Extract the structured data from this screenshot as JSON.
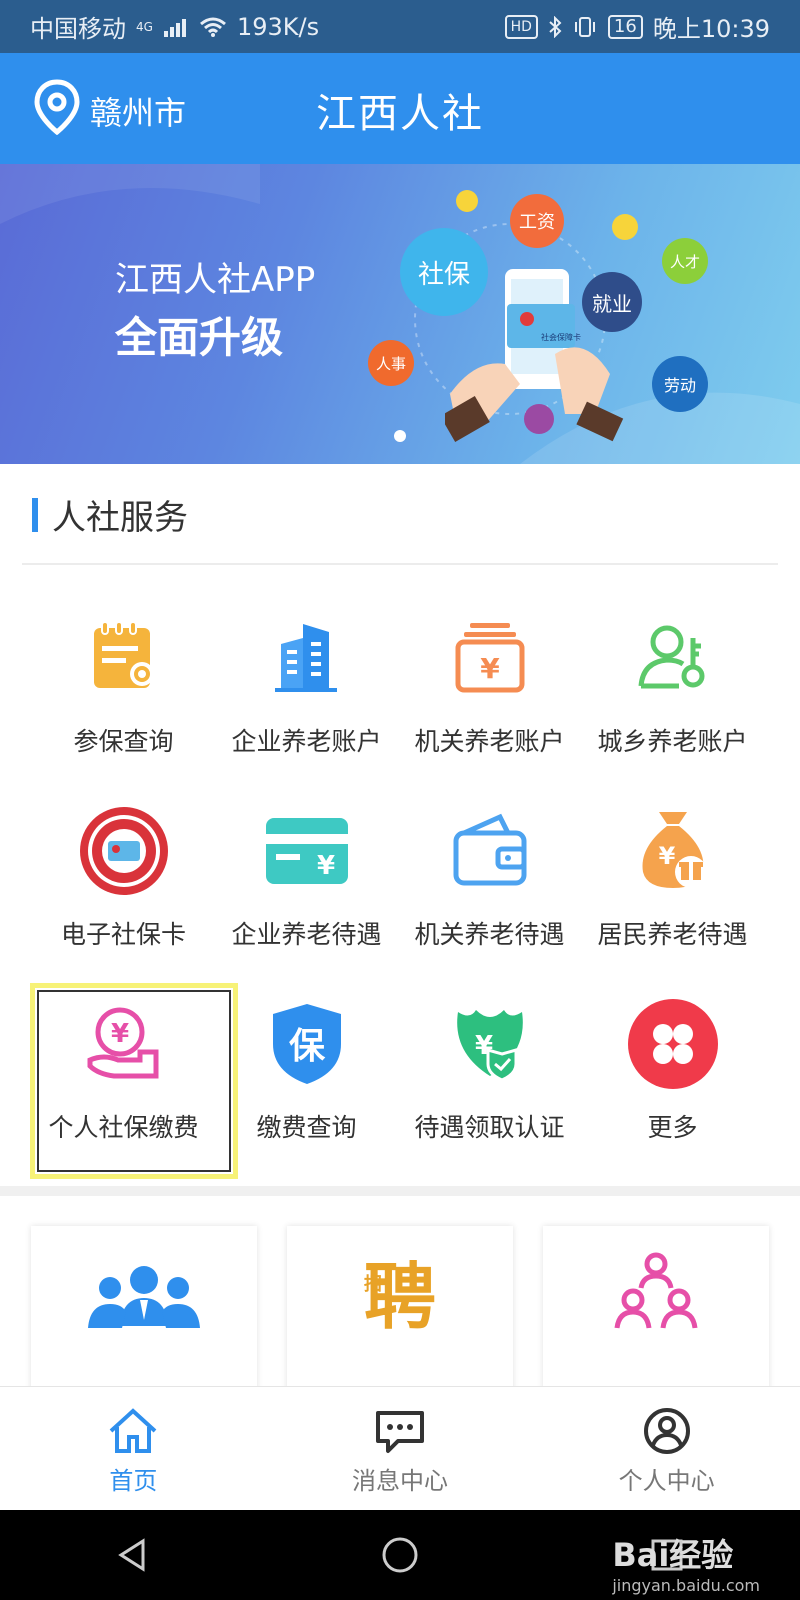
{
  "status_bar": {
    "carrier": "中国移动",
    "network": "4G",
    "speed": "193K/s",
    "hd": "HD",
    "battery": "16",
    "time": "晚上10:39"
  },
  "header": {
    "location": "赣州市",
    "title": "江西人社"
  },
  "banner": {
    "line1": "江西人社APP",
    "line2": "全面升级",
    "bubbles": [
      "社保",
      "工资",
      "就业",
      "人才",
      "人事",
      "劳动"
    ],
    "card_text": "社会保障卡"
  },
  "services": {
    "title": "人社服务",
    "items": [
      {
        "label": "参保查询",
        "icon": "clipboard-search-icon",
        "color": "#f5b43c"
      },
      {
        "label": "企业养老账户",
        "icon": "building-icon",
        "color": "#2f8fed"
      },
      {
        "label": "机关养老账户",
        "icon": "yuan-box-icon",
        "color": "#f58c52"
      },
      {
        "label": "城乡养老账户",
        "icon": "person-key-icon",
        "color": "#5cc96a"
      },
      {
        "label": "电子社保卡",
        "icon": "social-security-card-icon",
        "color": "#d9333a"
      },
      {
        "label": "企业养老待遇",
        "icon": "yuan-card-icon",
        "color": "#3ec9c3"
      },
      {
        "label": "机关养老待遇",
        "icon": "wallet-icon",
        "color": "#4da3f0"
      },
      {
        "label": "居民养老待遇",
        "icon": "money-bag-icon",
        "color": "#f5a34d"
      },
      {
        "label": "个人社保缴费",
        "icon": "hand-yuan-icon",
        "color": "#e64fa8"
      },
      {
        "label": "缴费查询",
        "icon": "shield-bao-icon",
        "color": "#2f8fed"
      },
      {
        "label": "待遇领取认证",
        "icon": "leaf-yuan-icon",
        "color": "#2dbf7f"
      },
      {
        "label": "更多",
        "icon": "more-icon",
        "color": "#f03a4a"
      }
    ],
    "bao_char": "保",
    "yuan_char": "¥"
  },
  "cards": [
    {
      "icon": "people-group-icon",
      "color": "#2f8fed"
    },
    {
      "icon": "recruit-icon",
      "color": "#e8a227",
      "glyph": "聘",
      "small": "招"
    },
    {
      "icon": "organization-icon",
      "color": "#e64fa8"
    }
  ],
  "tabs": [
    {
      "label": "首页",
      "icon": "home-icon",
      "active": true
    },
    {
      "label": "消息中心",
      "icon": "message-icon",
      "active": false
    },
    {
      "label": "个人中心",
      "icon": "user-icon",
      "active": false
    }
  ],
  "watermark": {
    "brand": "Bai经验",
    "url": "jingyan.baidu.com"
  }
}
